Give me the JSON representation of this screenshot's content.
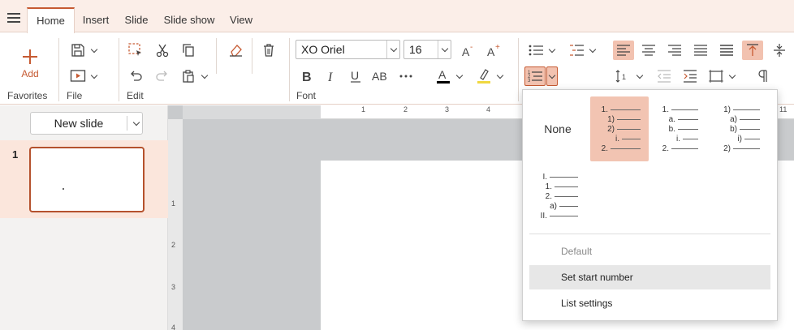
{
  "menubar": {
    "tabs": [
      "Home",
      "Insert",
      "Slide",
      "Slide show",
      "View"
    ],
    "active_tab": "Home"
  },
  "ribbon": {
    "favorites": {
      "add_label": "Add",
      "group_label": "Favorites"
    },
    "file": {
      "group_label": "File"
    },
    "edit": {
      "group_label": "Edit"
    },
    "font": {
      "group_label": "Font",
      "font_name": "XO Oriel",
      "font_size": "16",
      "font_color": "#000000",
      "highlight_color": "#f0d840"
    },
    "accent_color": "#c65a32"
  },
  "left_panel": {
    "new_slide_label": "New slide",
    "slides": [
      {
        "number": "1"
      }
    ]
  },
  "ruler": {
    "top_numbers": [
      "1",
      "2",
      "3",
      "4",
      "11"
    ],
    "left_numbers": [
      "1",
      "2",
      "3",
      "4"
    ]
  },
  "numbering_popup": {
    "none_label": "None",
    "presets": [
      {
        "markers": [
          "1.",
          "1)",
          "2)",
          "i.",
          "2."
        ],
        "selected": true
      },
      {
        "markers": [
          "1.",
          "a.",
          "b.",
          "i.",
          "2."
        ],
        "selected": false
      },
      {
        "markers": [
          "1)",
          "a)",
          "b)",
          "i)",
          "2)"
        ],
        "selected": false
      },
      {
        "markers": [
          "I.",
          "1.",
          "2.",
          "a)",
          "II."
        ],
        "selected": false
      }
    ],
    "menu_items": [
      {
        "label": "Default",
        "disabled": true
      },
      {
        "label": "Set start number",
        "disabled": false,
        "hover": true
      },
      {
        "label": "List settings",
        "disabled": false
      }
    ]
  }
}
